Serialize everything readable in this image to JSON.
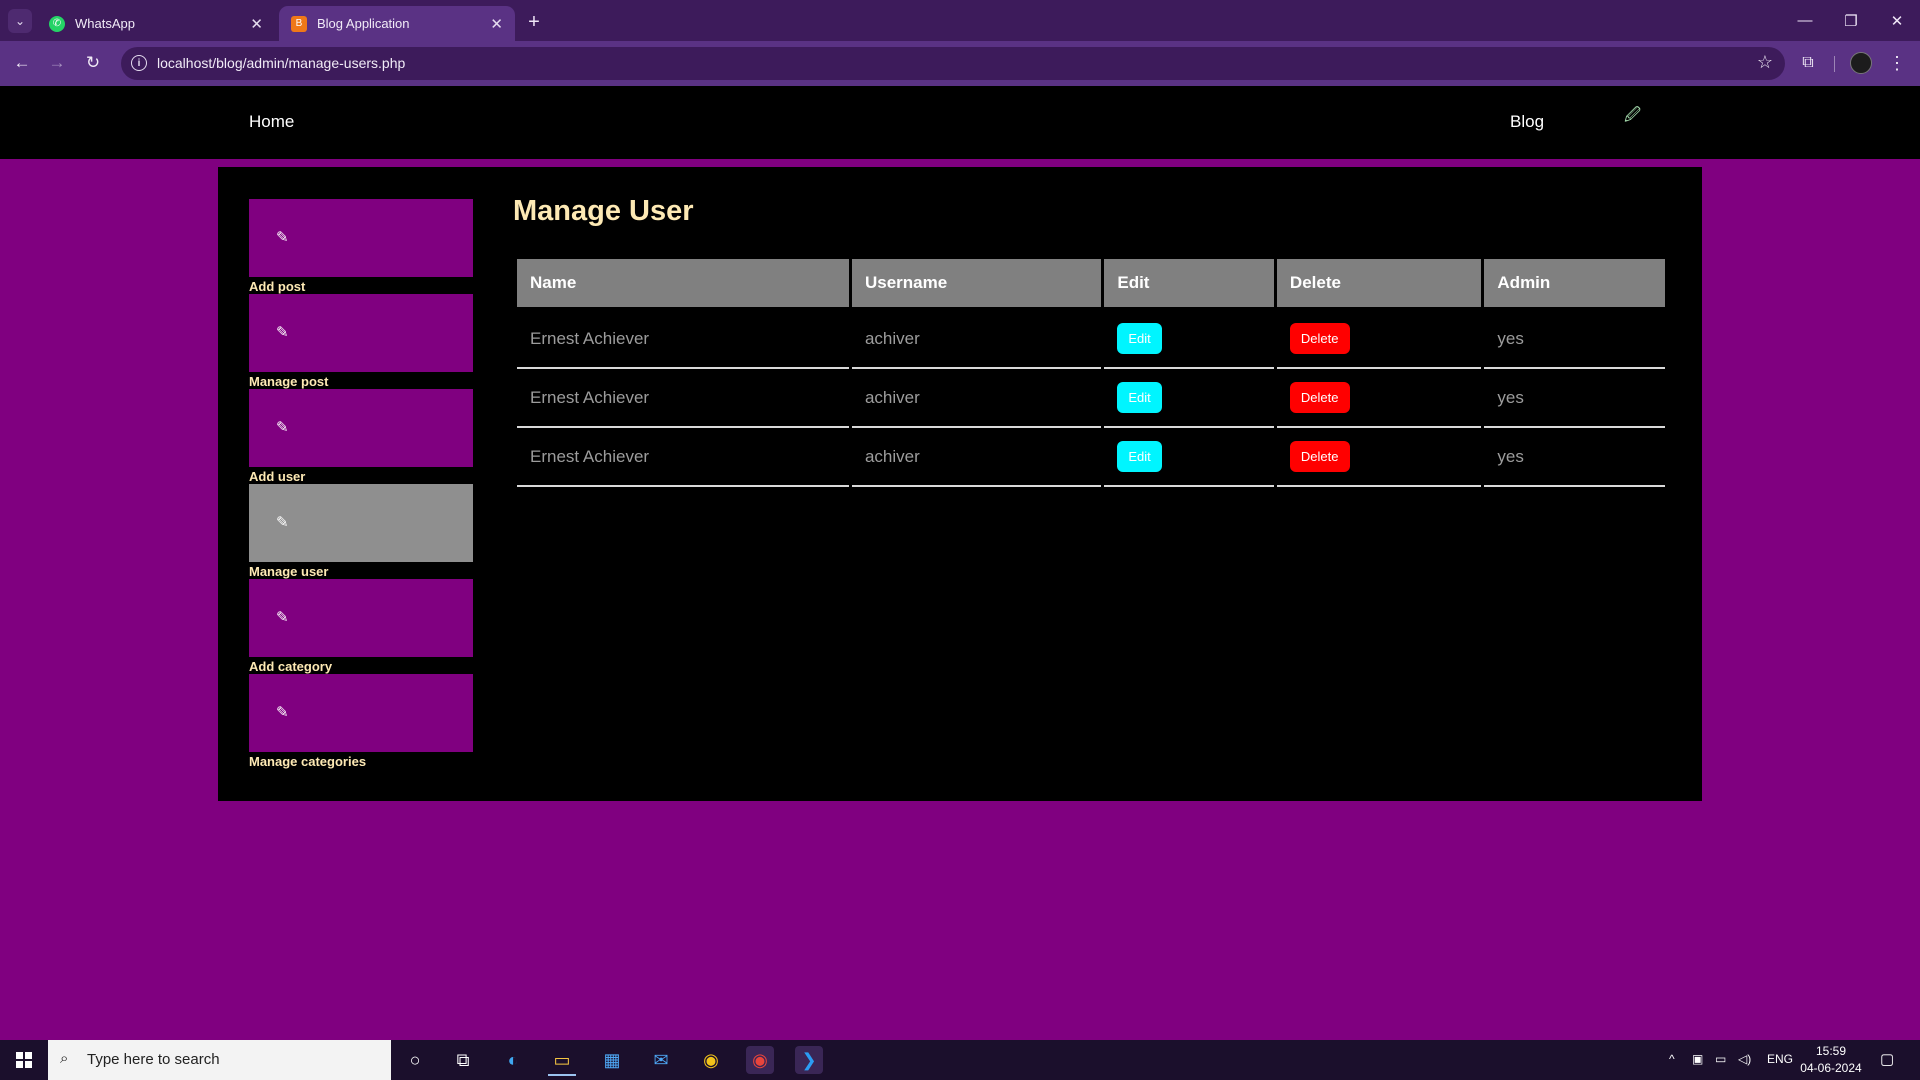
{
  "browser": {
    "tabs": [
      {
        "title": "WhatsApp",
        "icon": "whatsapp-icon"
      },
      {
        "title": "Blog Application",
        "icon": "blog-favicon-icon"
      }
    ],
    "url": "localhost/blog/admin/manage-users.php"
  },
  "site_nav": {
    "home": "Home",
    "blog": "Blog"
  },
  "page": {
    "title": "Manage User"
  },
  "sidebar": {
    "items": [
      {
        "label": "Add post",
        "active": false
      },
      {
        "label": "Manage post",
        "active": false
      },
      {
        "label": "Add user",
        "active": false
      },
      {
        "label": "Manage user",
        "active": true
      },
      {
        "label": "Add category",
        "active": false
      },
      {
        "label": "Manage categories",
        "active": false
      }
    ]
  },
  "table": {
    "headers": [
      "Name",
      "Username",
      "Edit",
      "Delete",
      "Admin"
    ],
    "rows": [
      {
        "name": "Ernest Achiever",
        "username": "achiver",
        "edit": "Edit",
        "delete": "Delete",
        "admin": "yes"
      },
      {
        "name": "Ernest Achiever",
        "username": "achiver",
        "edit": "Edit",
        "delete": "Delete",
        "admin": "yes"
      },
      {
        "name": "Ernest Achiever",
        "username": "achiver",
        "edit": "Edit",
        "delete": "Delete",
        "admin": "yes"
      }
    ]
  },
  "taskbar": {
    "search_placeholder": "Type here to search",
    "language": "ENG",
    "time": "15:59",
    "date": "04-06-2024"
  },
  "colors": {
    "page_background": "#800080",
    "panel_background": "#000000",
    "accent_text": "#fde9b4",
    "edit_button": "#00f5ff",
    "delete_button": "#ff0000",
    "active_sidebar": "#8f8f8f"
  }
}
